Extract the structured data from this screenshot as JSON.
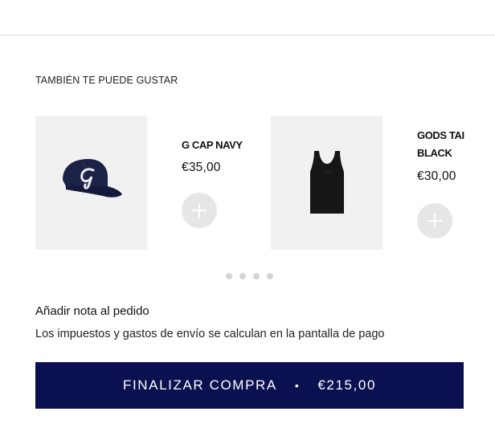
{
  "recommendations": {
    "heading": "TAMBIÉN TE PUEDE GUSTAR",
    "products": [
      {
        "name": "G CAP NAVY",
        "price": "€35,00",
        "image_icon": "navy-cap-icon"
      },
      {
        "name": "GODS TAI\nBLACK",
        "price": "€30,00",
        "image_icon": "black-tank-top-icon"
      }
    ],
    "pagination_dots": 4
  },
  "order_note": {
    "label": "Añadir nota al pedido"
  },
  "tax_note": "Los impuestos y gastos de envío se calculan en la pantalla de pago",
  "checkout": {
    "label": "FINALIZAR COMPRA",
    "separator": "•",
    "total": "€215,00"
  },
  "colors": {
    "checkout_bg": "#0b1150",
    "card_bg": "#f1f1f1",
    "add_button_bg": "#e6e6e6"
  }
}
